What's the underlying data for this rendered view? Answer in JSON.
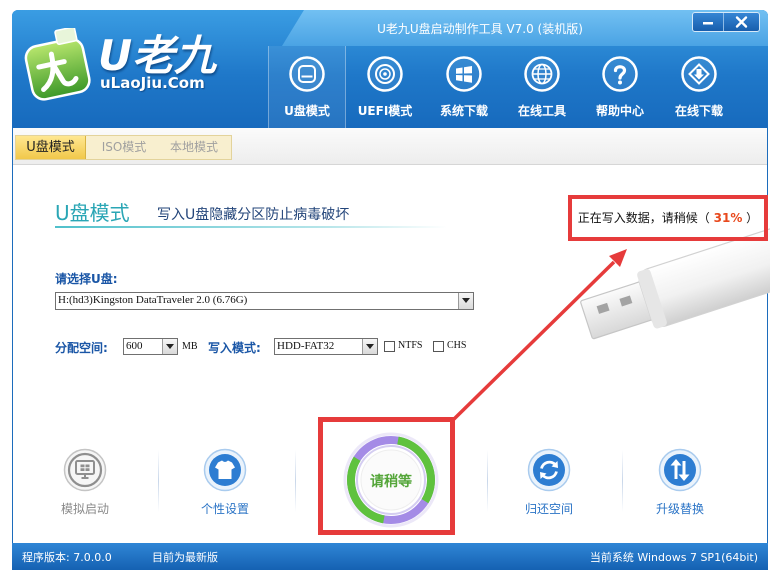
{
  "window": {
    "title": "U老九U盘启动制作工具 V7.0 (装机版)"
  },
  "logo": {
    "brand": "U老九",
    "site": "uLaoJiu.Com"
  },
  "window_controls": [
    {
      "icon": "minimize-icon"
    },
    {
      "icon": "close-icon"
    }
  ],
  "nav": [
    {
      "label": "U盘模式",
      "icon": "usb-disk-icon",
      "selected": true
    },
    {
      "label": "UEFI模式",
      "icon": "disc-icon",
      "selected": false
    },
    {
      "label": "系统下载",
      "icon": "windows-logo-icon",
      "selected": false
    },
    {
      "label": "在线工具",
      "icon": "globe-icon",
      "selected": false
    },
    {
      "label": "帮助中心",
      "icon": "question-icon",
      "selected": false
    },
    {
      "label": "在线下载",
      "icon": "download-box-icon",
      "selected": false
    }
  ],
  "mode_tabs": [
    {
      "label": "U盘模式",
      "selected": true
    },
    {
      "label": "ISO模式",
      "selected": false
    },
    {
      "label": "本地模式",
      "selected": false
    }
  ],
  "main": {
    "heading": "U盘模式",
    "subheading": "写入U盘隐藏分区防止病毒破坏",
    "status": {
      "prefix": "正在写入数据，请稍候（ ",
      "percent": "31%",
      "suffix": " ）"
    }
  },
  "form": {
    "disk": {
      "label": "请选择U盘:",
      "value": "H:(hd3)Kingston DataTraveler 2.0 (6.76G)"
    },
    "alloc": {
      "label": "分配空间:",
      "value": "600",
      "unit": "MB"
    },
    "write_mode": {
      "label": "写入模式:",
      "value": "HDD-FAT32"
    },
    "ntfs": {
      "label": "NTFS",
      "checked": false
    },
    "chs": {
      "label": "CHS",
      "checked": false
    }
  },
  "actions": [
    {
      "label": "模拟启动",
      "icon": "monitor-windows-icon",
      "enabled": false
    },
    {
      "label": "个性设置",
      "icon": "tshirt-icon",
      "enabled": true
    },
    {
      "label": "请稍等",
      "icon": "progress-ring-icon",
      "enabled": true
    },
    {
      "label": "归还空间",
      "icon": "refresh-icon",
      "enabled": true
    },
    {
      "label": "升级替换",
      "icon": "up-down-arrows-icon",
      "enabled": true
    }
  ],
  "footer": {
    "version": "程序版本: 7.0.0.0",
    "update_status": "目前为最新版",
    "system": "当前系统 Windows 7 SP1(64bit)"
  },
  "colors": {
    "accent": "#2aa6b5",
    "header": "#176abd",
    "highlight_red": "#e63b3b",
    "progress_green": "#55a63a",
    "progress_purple": "#a48be6"
  }
}
